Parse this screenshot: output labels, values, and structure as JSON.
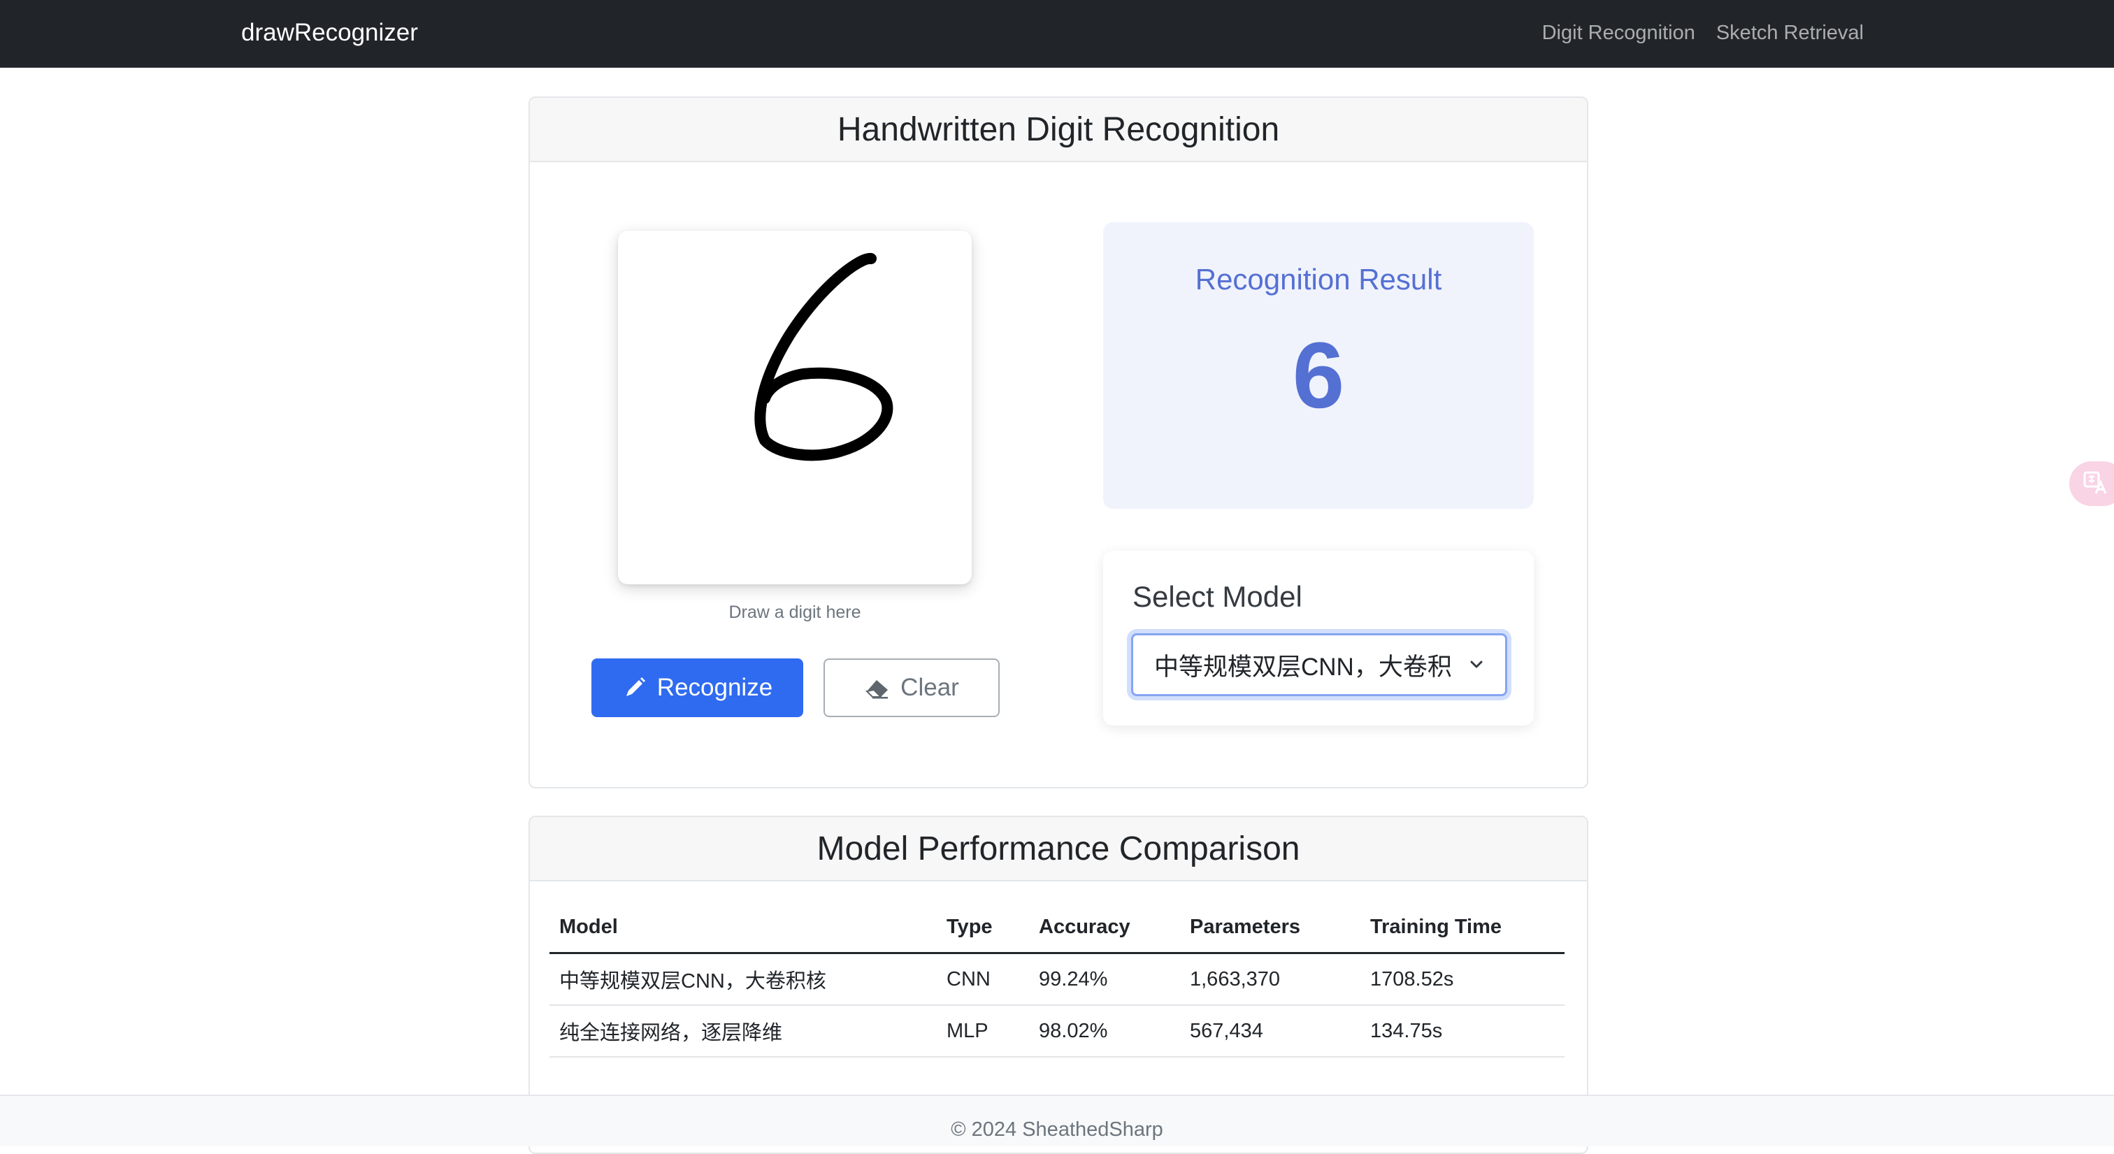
{
  "navbar": {
    "brand": "drawRecognizer",
    "links": [
      "Digit Recognition",
      "Sketch Retrieval"
    ]
  },
  "recognition": {
    "title": "Handwritten Digit Recognition",
    "canvas_hint": "Draw a digit here",
    "recognize_label": "Recognize",
    "clear_label": "Clear",
    "result_label": "Recognition Result",
    "result_value": "6",
    "select_label": "Select Model",
    "selected_model": "中等规模双层CNN，大卷积"
  },
  "performance": {
    "title": "Model Performance Comparison",
    "headers": [
      "Model",
      "Type",
      "Accuracy",
      "Parameters",
      "Training Time"
    ],
    "rows": [
      [
        "中等规模双层CNN，大卷积核",
        "CNN",
        "99.24%",
        "1,663,370",
        "1708.52s"
      ],
      [
        "纯全连接网络，逐层降维",
        "MLP",
        "98.02%",
        "567,434",
        "134.75s"
      ]
    ]
  },
  "footer": {
    "text": "© 2024 SheathedSharp"
  },
  "icons": {
    "recognize": "pencil-icon",
    "clear": "eraser-icon",
    "select": "chevron-down-icon",
    "float": "translate-icon"
  },
  "colors": {
    "navbar_bg": "#212529",
    "primary": "#2f6bf0",
    "result_accent": "#5570d3",
    "result_bg": "#f0f3fc"
  }
}
